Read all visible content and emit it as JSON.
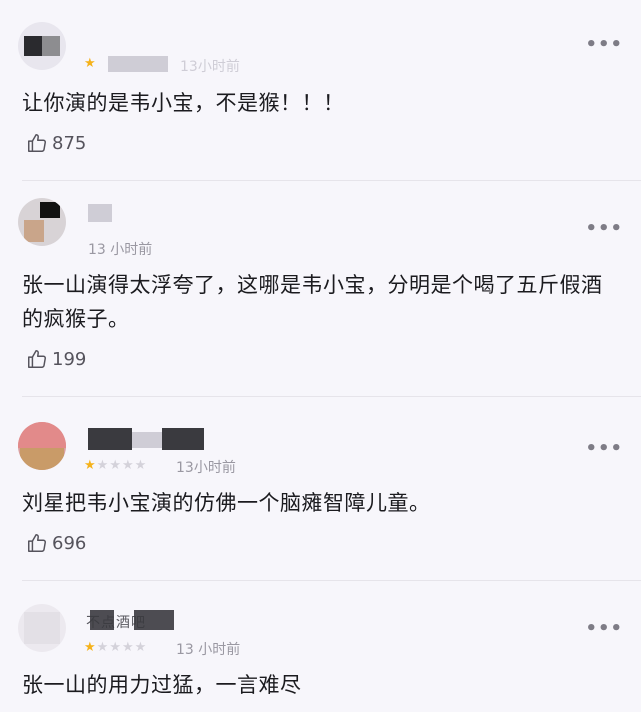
{
  "comments": [
    {
      "time": "13小时前",
      "stars": 1,
      "text": "让你演的是韦小宝，不是猴！！！",
      "likes": "875"
    },
    {
      "time": "13 小时前",
      "text": "张一山演得太浮夸了，这哪是韦小宝，分明是个喝了五斤假酒的疯猴子。",
      "likes": "199"
    },
    {
      "time": "13小时前",
      "stars": 1,
      "text": "刘星把韦小宝演的仿佛一个脑瘫智障儿童。",
      "likes": "696"
    },
    {
      "name_visible": "不点酒吧",
      "time": "13 小时前",
      "stars": 1,
      "text": "张一山的用力过猛，一言难尽"
    }
  ],
  "icons": {
    "more": "more-dots-icon",
    "like": "thumbs-up-icon",
    "star": "star-icon"
  },
  "colors": {
    "star_active": "#f5b21b",
    "star_inactive": "#d4d2da",
    "background": "#f7f6fb"
  }
}
